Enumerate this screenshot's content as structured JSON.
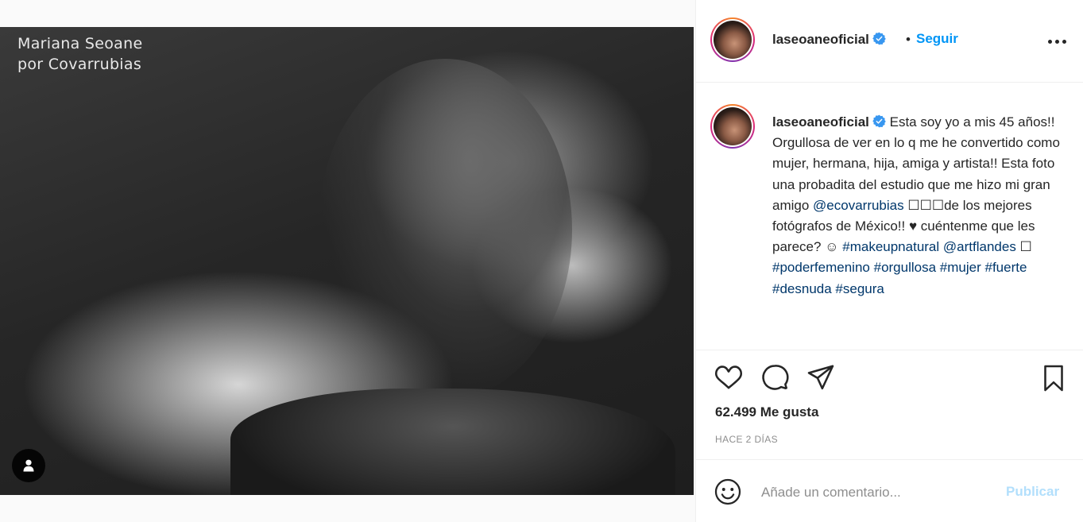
{
  "media": {
    "watermark_line1": "Mariana Seoane",
    "watermark_line2": "por Covarrubias"
  },
  "header": {
    "username": "laseoaneoficial",
    "separator": "•",
    "follow_label": "Seguir"
  },
  "caption": {
    "username": "laseoaneoficial",
    "text_part1": " Esta soy yo a mis 45 años!! Orgullosa de ver en lo q me he convertido como mujer, hermana, hija, amiga y artista!! Esta foto una probadita del estudio que me hizo mi gran amigo ",
    "mention1": "@ecovarrubias",
    "text_part2": " ☐☐☐de los mejores fotógrafos de México!! ♥ cuéntenme que les parece? ☺ ",
    "hashtag1": "#makeupnatural",
    "mention2": "@artflandes",
    "text_part3": " ☐ ",
    "hashtag2": "#poderfemenino",
    "hashtag3": "#orgullosa",
    "hashtag4": "#mujer",
    "hashtag5": "#fuerte",
    "hashtag6": "#desnuda",
    "hashtag7": "#segura"
  },
  "actions": {
    "likes": "62.499 Me gusta",
    "time_ago": "HACE 2 DÍAS"
  },
  "comment": {
    "placeholder": "Añade un comentario...",
    "post_label": "Publicar"
  },
  "colors": {
    "accent": "#0095f6",
    "link": "#00376b",
    "muted": "#8e8e8e",
    "post_disabled": "#b2dffc",
    "verified": "#3897f0"
  },
  "icons": [
    "heart-icon",
    "comment-icon",
    "share-icon",
    "bookmark-icon",
    "emoji-icon",
    "more-icon",
    "verified-icon",
    "user-tag-icon"
  ]
}
